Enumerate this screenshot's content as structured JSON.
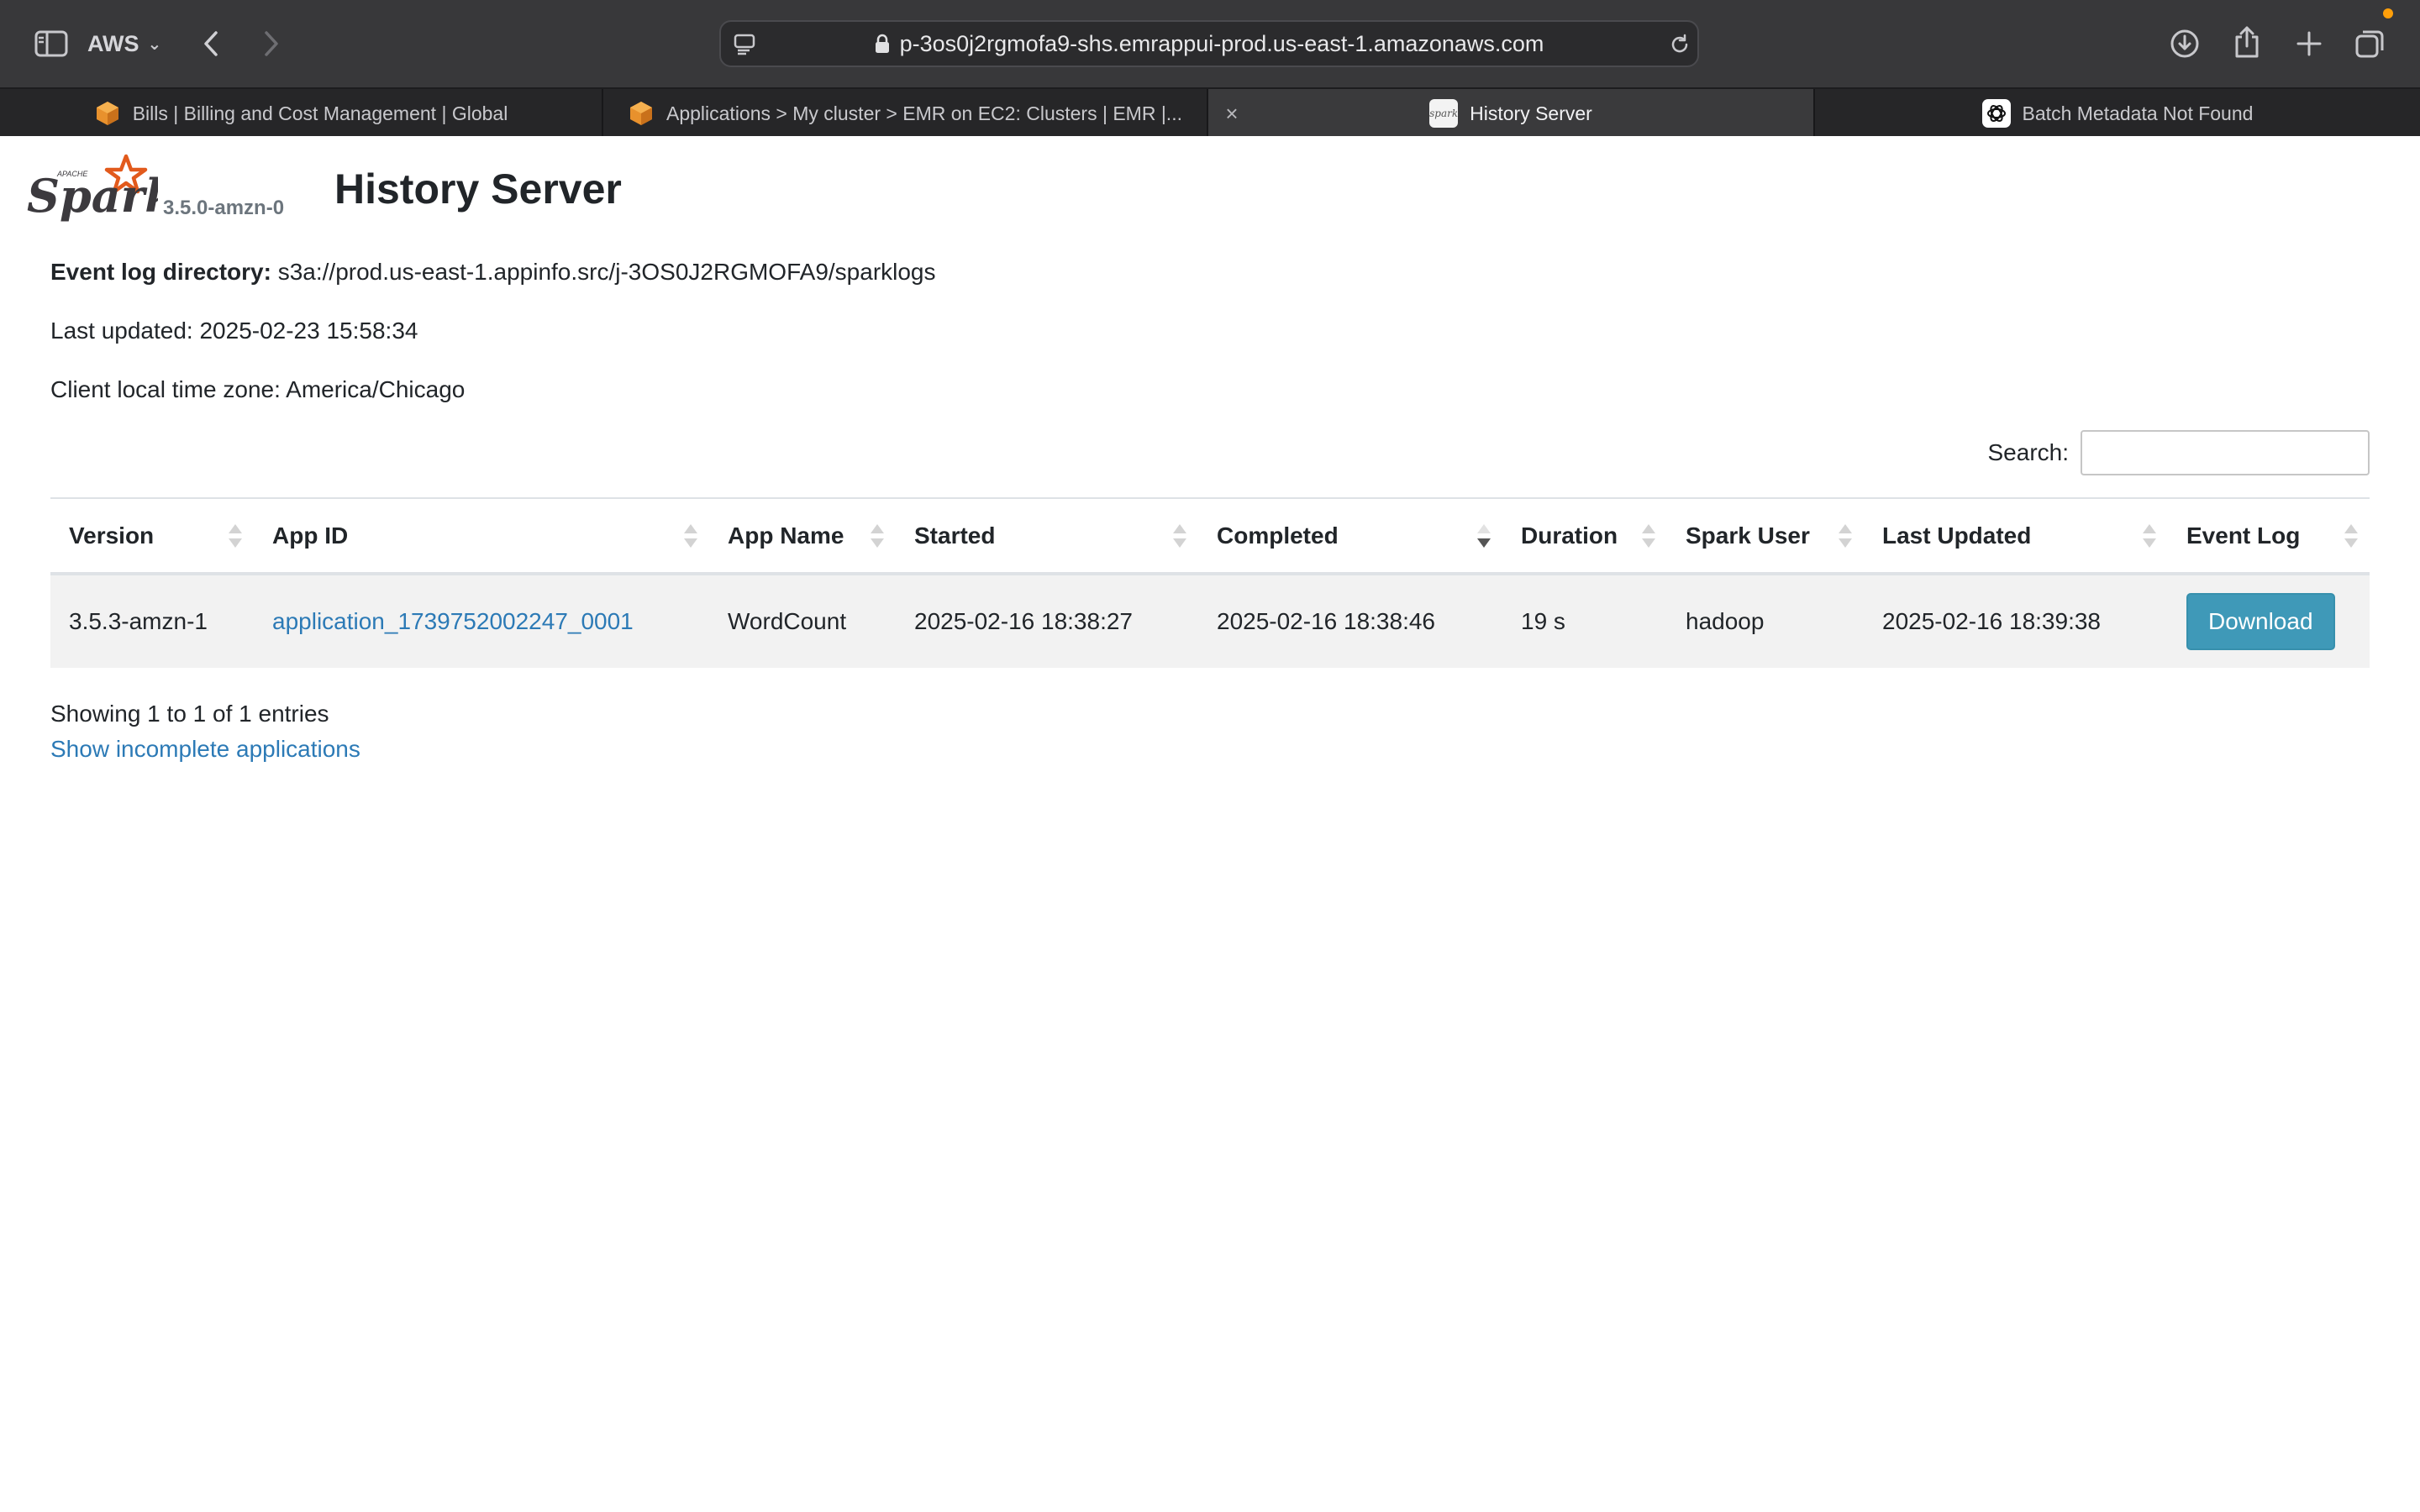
{
  "browser": {
    "profile_label": "AWS",
    "url": "p-3os0j2rgmofa9-shs.emrappui-prod.us-east-1.amazonaws.com",
    "tabs": [
      {
        "title": "Bills | Billing and Cost Management | Global",
        "favicon": "aws-cube-icon",
        "active": false
      },
      {
        "title": "Applications > My cluster > EMR on EC2: Clusters | EMR |...",
        "favicon": "aws-cube-icon",
        "active": false
      },
      {
        "title": "History Server",
        "favicon": "spark-icon",
        "active": true
      },
      {
        "title": "Batch Metadata Not Found",
        "favicon": "openai-icon",
        "active": false
      }
    ],
    "accent_color": "#ff9f0a"
  },
  "header": {
    "logo_text": "Spark",
    "logo_apache": "APACHE",
    "version": "3.5.0-amzn-0",
    "title": "History Server"
  },
  "info": {
    "event_log_label": "Event log directory:",
    "event_log_value": "s3a://prod.us-east-1.appinfo.src/j-3OS0J2RGMOFA9/sparklogs",
    "last_updated": "Last updated: 2025-02-23 15:58:34",
    "timezone": "Client local time zone: America/Chicago"
  },
  "search": {
    "label": "Search:",
    "value": "",
    "placeholder": ""
  },
  "table": {
    "columns": [
      "Version",
      "App ID",
      "App Name",
      "Started",
      "Completed",
      "Duration",
      "Spark User",
      "Last Updated",
      "Event Log"
    ],
    "sorted_column": "Completed",
    "sort_direction": "descending",
    "rows": [
      {
        "version": "3.5.3-amzn-1",
        "app_id": "application_1739752002247_0001",
        "app_name": "WordCount",
        "started": "2025-02-16 18:38:27",
        "completed": "2025-02-16 18:38:46",
        "duration": "19 s",
        "spark_user": "hadoop",
        "last_updated": "2025-02-16 18:39:38",
        "event_log": "Download"
      }
    ]
  },
  "footer": {
    "showing": "Showing 1 to 1 of 1 entries",
    "incomplete_link": "Show incomplete applications"
  },
  "colors": {
    "link": "#2c7ab6",
    "download_button": "#3f99b8",
    "spark_orange": "#e25a1c"
  }
}
